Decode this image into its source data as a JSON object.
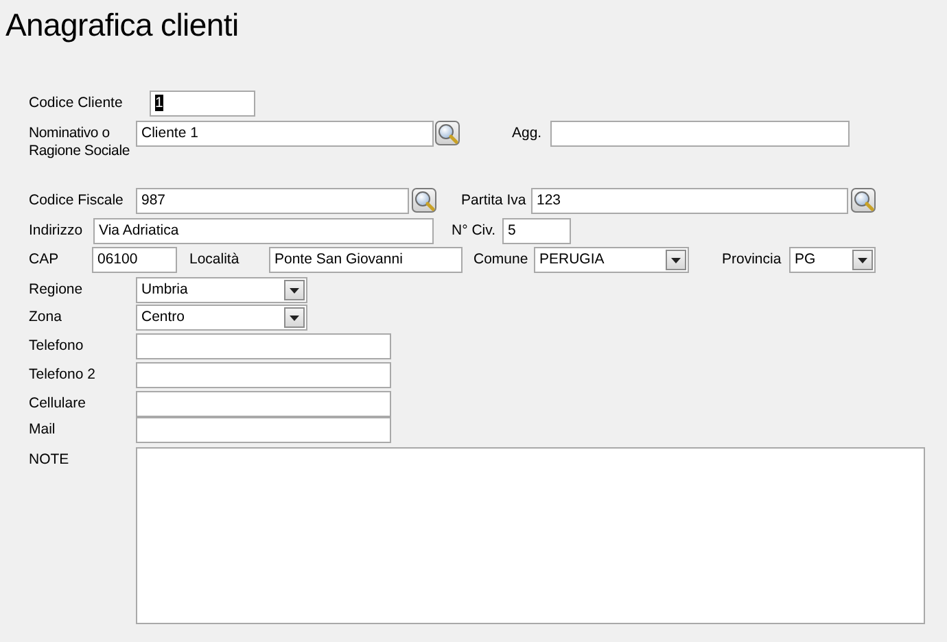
{
  "title": "Anagrafica clienti",
  "rows": [
    [
      {
        "kind": "label",
        "text": "Codice Cliente"
      },
      {
        "kind": "field",
        "value": "1",
        "text_selected": true
      }
    ],
    [
      {
        "kind": "label",
        "text": "Nominativo o Ragione Sociale"
      },
      {
        "kind": "field",
        "value": "Cliente 1",
        "text_selected": false
      },
      {
        "kind": "search"
      },
      {
        "kind": "label",
        "text": "Agg."
      },
      {
        "kind": "field"
      }
    ],
    [
      {
        "kind": "label",
        "text": "Codice Fiscale"
      },
      {
        "kind": "field",
        "value": "987",
        "text_selected": false
      },
      {
        "kind": "search"
      },
      {
        "kind": "label",
        "text": "Partita Iva"
      },
      {
        "kind": "field",
        "value": "123",
        "text_selected": false
      },
      {
        "kind": "search"
      }
    ],
    [
      {
        "kind": "label",
        "text": "Indirizzo"
      },
      {
        "kind": "field",
        "value": "Via Adriatica",
        "text_selected": false
      },
      {
        "kind": "label",
        "text": "N° Civ."
      },
      {
        "kind": "field",
        "value": "5",
        "text_selected": false
      }
    ],
    [
      {
        "kind": "label",
        "text": "CAP"
      },
      {
        "kind": "field",
        "value": "06100",
        "text_selected": false
      },
      {
        "kind": "label",
        "text": "Località"
      },
      {
        "kind": "field",
        "value": "Ponte San Giovanni",
        "text_selected": false
      },
      {
        "kind": "label",
        "text": "Comune"
      },
      {
        "kind": "combo",
        "value": "PERUGIA"
      },
      {
        "kind": "label",
        "text": "Provincia"
      },
      {
        "kind": "combo",
        "value": "PG"
      }
    ],
    [
      {
        "kind": "label",
        "text": "Regione"
      },
      {
        "kind": "combo",
        "value": "Umbria"
      }
    ],
    [
      {
        "kind": "label",
        "text": "Zona"
      },
      {
        "kind": "combo",
        "value": "Centro"
      }
    ],
    [
      {
        "kind": "label",
        "text": "Telefono"
      },
      {
        "kind": "field"
      }
    ],
    [
      {
        "kind": "label",
        "text": "Telefono 2"
      },
      {
        "kind": "field"
      }
    ],
    [
      {
        "kind": "label",
        "text": "Cellulare"
      },
      {
        "kind": "field"
      }
    ],
    [
      {
        "kind": "label",
        "text": "Mail"
      },
      {
        "kind": "field"
      }
    ],
    [
      {
        "kind": "label",
        "text": "NOTE"
      },
      {
        "kind": "textarea"
      }
    ]
  ]
}
